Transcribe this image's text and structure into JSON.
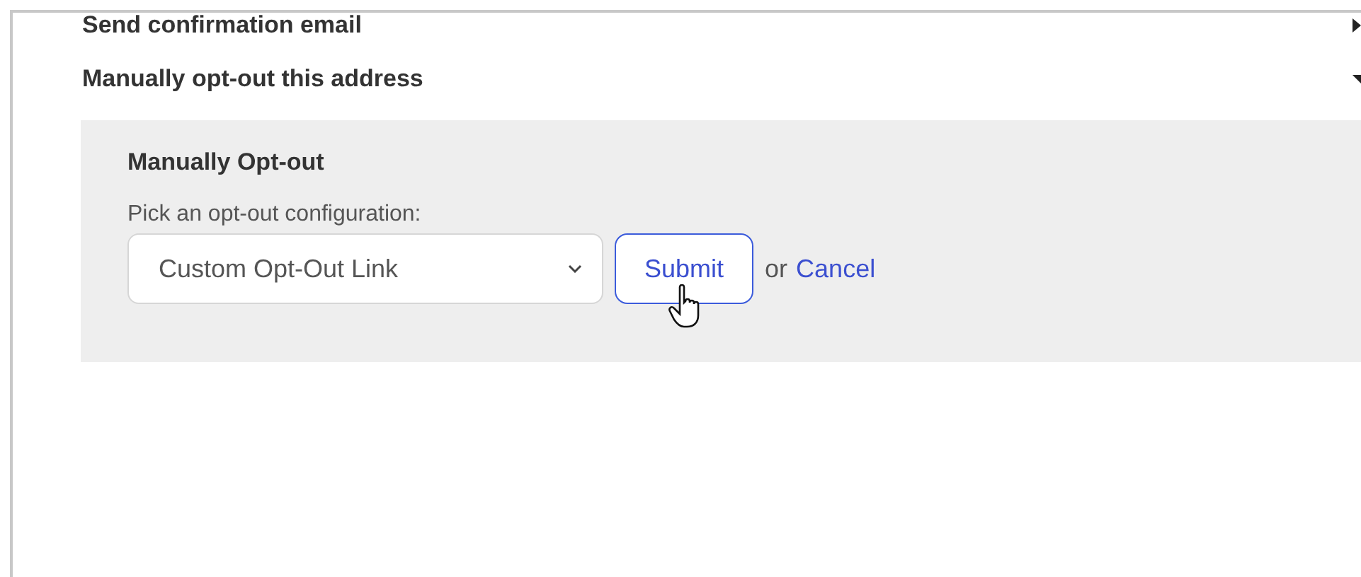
{
  "sections": [
    {
      "title": "Send confirmation email",
      "expanded": false
    },
    {
      "title": "Manually opt-out this address",
      "expanded": true
    }
  ],
  "panel": {
    "heading": "Manually Opt-out",
    "label": "Pick an opt-out configuration:",
    "select_value": "Custom Opt-Out Link",
    "submit": "Submit",
    "or": "or",
    "cancel": "Cancel"
  }
}
